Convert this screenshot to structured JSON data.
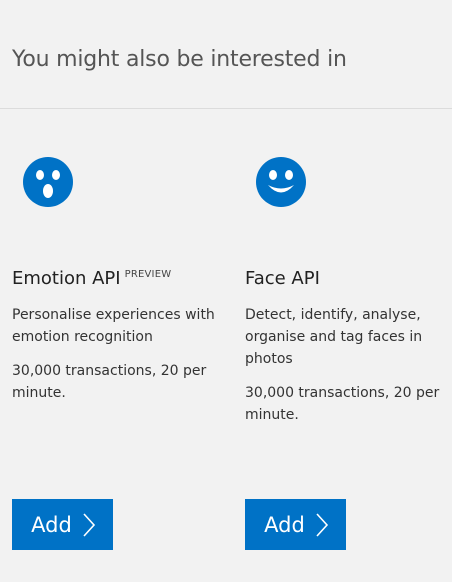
{
  "section": {
    "title": "You might also be interested in"
  },
  "colors": {
    "accent": "#0072c6",
    "background": "#f2f2f2"
  },
  "cards": [
    {
      "icon": "surprised-face-icon",
      "title": "Emotion API",
      "badge": "PREVIEW",
      "description": "Personalise experiences with emotion recognition",
      "pricing": "30,000 transactions, 20 per minute.",
      "button_label": "Add",
      "button_icon": "chevron-right-icon"
    },
    {
      "icon": "smiling-face-icon",
      "title": "Face API",
      "badge": "",
      "description": "Detect, identify, analyse, organise and tag faces in photos",
      "pricing": "30,000 transactions, 20 per minute.",
      "button_label": "Add",
      "button_icon": "chevron-right-icon"
    }
  ]
}
